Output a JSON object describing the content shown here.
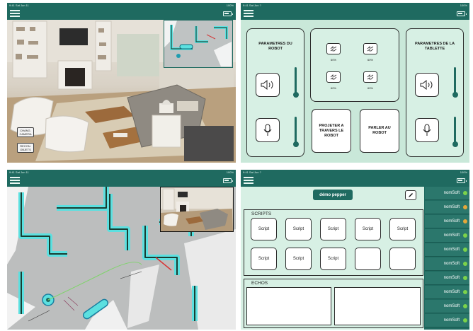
{
  "status": {
    "time_a": "9:41 Sat Jun 11",
    "time_b": "9:41 Sat Jun ?",
    "battery_text": "100%"
  },
  "camera_view": {
    "change_camera": "CHANG. CAMERA",
    "recognize_objects": "RECON. OBJETS"
  },
  "controls": {
    "robot_params_title": "PARAMETRES DU ROBOT",
    "tablet_params_title": "PARAMETRES DE LA TABLETTE",
    "batteries": [
      {
        "pct": "60%"
      },
      {
        "pct": "60%"
      },
      {
        "pct": "60%"
      },
      {
        "pct": "60%"
      }
    ],
    "project_button": "PROJETER A TRAVERS LE ROBOT",
    "speak_button": "PARLER AU ROBOT",
    "slider_levels": {
      "robot_volume": 0.0,
      "robot_mic": 0.0,
      "tablet_volume": 0.0,
      "tablet_mic": 0.0
    }
  },
  "scripts_screen": {
    "robot_name": "démo pepper",
    "scripts_title": "SCRIPTS",
    "script_label": "Script",
    "scripts": [
      "Script",
      "Script",
      "Script",
      "Script",
      "Script",
      "Script",
      "Script",
      "Script",
      "",
      ""
    ],
    "echos_title": "ECHOS",
    "soft_items": [
      {
        "label": "nomSoft",
        "status_color": "#7bd24a"
      },
      {
        "label": "nomSoft",
        "status_color": "#e4a83a"
      },
      {
        "label": "nomSoft",
        "status_color": "#e4a83a"
      },
      {
        "label": "nomSoft",
        "status_color": "#7bd24a"
      },
      {
        "label": "nomSoft",
        "status_color": "#7bd24a"
      },
      {
        "label": "nomSoft",
        "status_color": "#7bd24a"
      },
      {
        "label": "nomSoft",
        "status_color": "#7bd24a"
      },
      {
        "label": "nomSoft",
        "status_color": "#7bd24a"
      },
      {
        "label": "nomSoft",
        "status_color": "#7bd24a"
      },
      {
        "label": "nomSoft",
        "status_color": "#7bd24a"
      }
    ]
  },
  "colors": {
    "primary": "#1f6a60",
    "surface": "#d7f0e4",
    "accent_cyan": "#5ce0e0"
  }
}
